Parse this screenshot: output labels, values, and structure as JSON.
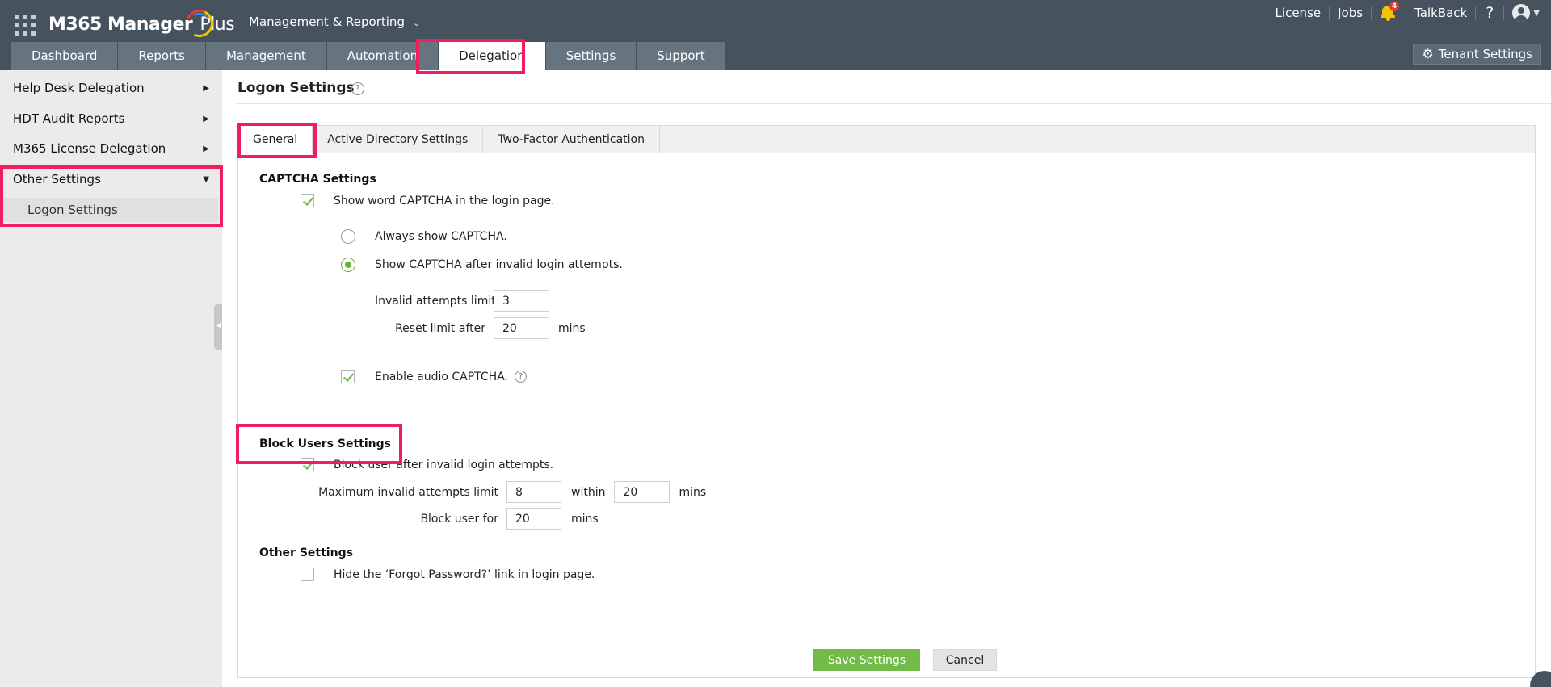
{
  "app": {
    "name": "M365 Manager Plus",
    "name_main": "M365 Manager",
    "name_suffix": "Plus",
    "context_menu": "Management & Reporting"
  },
  "top_right": {
    "license": "License",
    "jobs": "Jobs",
    "notification_count": "4",
    "talkback": "TalkBack",
    "help": "?"
  },
  "nav": {
    "tabs": [
      "Dashboard",
      "Reports",
      "Management",
      "Automation",
      "Delegation",
      "Settings",
      "Support"
    ],
    "active": "Delegation",
    "tenant_settings": "Tenant Settings"
  },
  "sidebar": {
    "items": [
      {
        "label": "Help Desk Delegation"
      },
      {
        "label": "HDT Audit Reports"
      },
      {
        "label": "M365 License Delegation"
      },
      {
        "label": "Other Settings"
      }
    ],
    "sub_item": "Logon Settings"
  },
  "page": {
    "title": "Logon Settings",
    "tabs": [
      "General",
      "Active Directory Settings",
      "Two-Factor Authentication"
    ],
    "active_tab": "General"
  },
  "captcha": {
    "heading": "CAPTCHA Settings",
    "show_word_captcha": {
      "label": "Show word CAPTCHA in the login page.",
      "checked": true
    },
    "always_show": {
      "label": "Always show CAPTCHA.",
      "selected": false
    },
    "show_after_invalid": {
      "label": "Show CAPTCHA after invalid login attempts.",
      "selected": true
    },
    "invalid_attempts_label": "Invalid attempts limit",
    "invalid_attempts_value": "3",
    "reset_limit_label": "Reset limit after",
    "reset_limit_value": "20",
    "reset_limit_unit": "mins",
    "enable_audio": {
      "label": "Enable audio CAPTCHA.",
      "checked": true
    }
  },
  "block_users": {
    "heading": "Block Users Settings",
    "block_user": {
      "label": "Block user after invalid login attempts.",
      "checked": true
    },
    "max_attempts_label": "Maximum invalid attempts limit",
    "max_attempts_value": "8",
    "within_label": "within",
    "within_value": "20",
    "within_unit": "mins",
    "block_for_label": "Block user for",
    "block_for_value": "20",
    "block_for_unit": "mins"
  },
  "other_settings": {
    "heading": "Other Settings",
    "hide_forgot": {
      "label": "Hide the ‘Forgot Password?’ link in login page.",
      "checked": false
    }
  },
  "actions": {
    "save": "Save Settings",
    "cancel": "Cancel"
  },
  "colors": {
    "topbar": "#46535e",
    "nav_tab": "#667480",
    "highlight": "#ef1f5e",
    "accent_green": "#72bb48",
    "sidebar_bg": "#ebebeb"
  }
}
